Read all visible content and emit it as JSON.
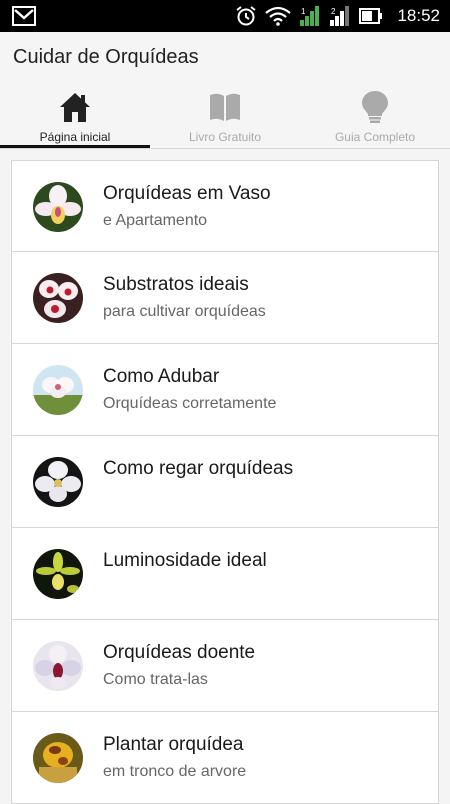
{
  "status_bar": {
    "time": "18:52",
    "icons": [
      "gmail-icon",
      "alarm-icon",
      "wifi-icon",
      "signal-icon",
      "signal-2-icon",
      "battery-icon"
    ]
  },
  "app": {
    "title": "Cuidar de Orquídeas"
  },
  "tabs": [
    {
      "label": "Página inicial",
      "icon": "home-icon",
      "active": true
    },
    {
      "label": "Livro Gratuito",
      "icon": "book-icon",
      "active": false
    },
    {
      "label": "Guia Completo",
      "icon": "lightbulb-icon",
      "active": false
    }
  ],
  "list": [
    {
      "title": "Orquídeas em Vaso",
      "subtitle": "e Apartamento"
    },
    {
      "title": "Substratos ideais",
      "subtitle": "para cultivar orquídeas"
    },
    {
      "title": "Como Adubar",
      "subtitle": "Orquídeas corretamente"
    },
    {
      "title": "Como regar orquídeas",
      "subtitle": ""
    },
    {
      "title": "Luminosidade ideal",
      "subtitle": ""
    },
    {
      "title": "Orquídeas doente",
      "subtitle": "Como trata-las"
    },
    {
      "title": "Plantar orquídea",
      "subtitle": "em tronco de arvore"
    }
  ],
  "colors": {
    "active_tab": "#111111",
    "inactive_tab": "#aaaaaa"
  }
}
